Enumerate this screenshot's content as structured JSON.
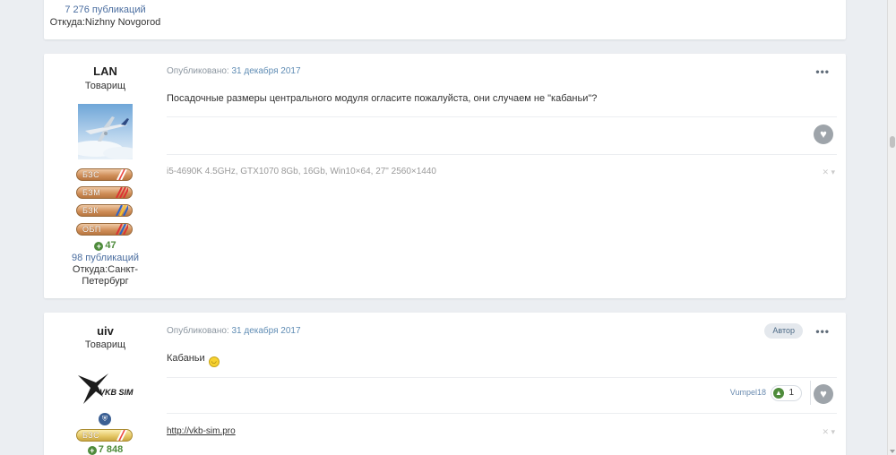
{
  "previous_post": {
    "publications": "7 276 публикаций",
    "location": "Откуда:Nizhny Novgorod"
  },
  "posts": [
    {
      "username": "LAN",
      "rank": "Товарищ",
      "badges": [
        "БЗС",
        "БЗМ",
        "БЗК",
        "ОБП"
      ],
      "reputation": "47",
      "publications": "98 публикаций",
      "location_line1": "Откуда:Санкт-",
      "location_line2": "Петербург",
      "posted_label": "Опубликовано:",
      "date": "31 декабря 2017",
      "more": "•••",
      "body": "Посадочные размеры центрального модуля огласите пожалуйста, они случаем не \"кабаньи\"?",
      "signature": "i5-4690K 4.5GHz, GTX1070 8Gb, 16Gb, Win10×64, 27\" 2560×1440"
    },
    {
      "username": "uiv",
      "rank": "Товарищ",
      "badges": [
        "БЗС"
      ],
      "reputation": "7 848",
      "logo_text": "VKB SIM",
      "posted_label": "Опубликовано:",
      "date": "31 декабря 2017",
      "author_tag": "Автор",
      "more": "•••",
      "body": "Кабаньи",
      "reactor": "Vumpel18",
      "reaction_count": "1",
      "signature_link": "http://vkb-sim.pro"
    }
  ],
  "colors": {
    "page_bg": "#ebeef2",
    "link_blue": "#5f8cb4",
    "rep_green": "#4e8b3b",
    "badge_bronze": "#cf8d57",
    "badge_gold": "#e3c562"
  }
}
